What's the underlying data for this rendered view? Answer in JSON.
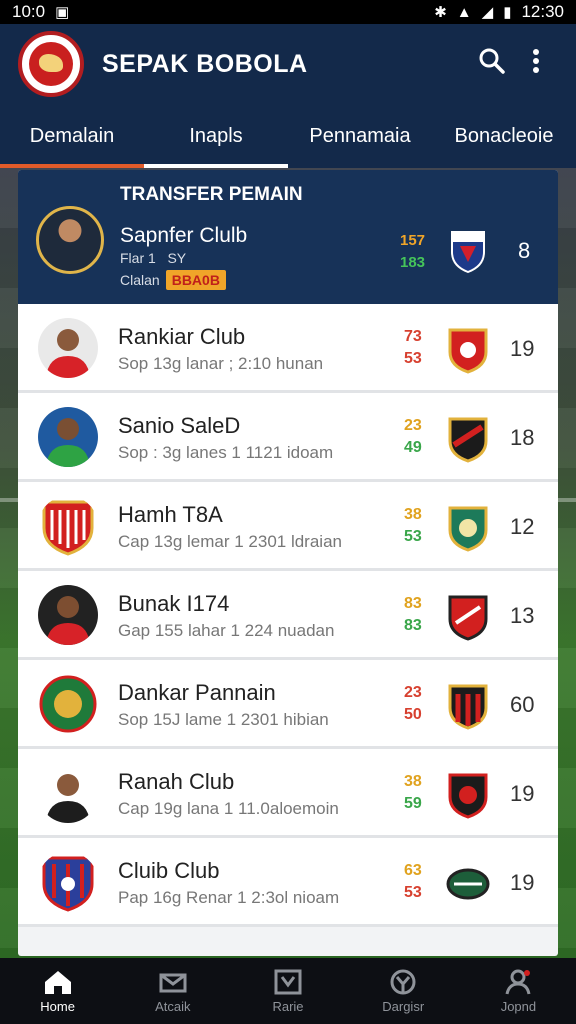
{
  "status_bar": {
    "time_left": "10:0",
    "time_right": "12:30"
  },
  "app": {
    "title": "SEPAK BOBOLA",
    "colors": {
      "header": "#13294a",
      "accent": "#e15b2a"
    }
  },
  "tabs": [
    {
      "label": "Demalain"
    },
    {
      "label": "Inapls"
    },
    {
      "label": "Pennamaia"
    },
    {
      "label": "Bonacleoie"
    }
  ],
  "featured": {
    "caption": "TRANSFER PEMAIN",
    "name": "Sapnfer Clulb",
    "line1": "Flar 1   SY",
    "line2_label": "Clalan",
    "badge": "BBA0B",
    "score_top": "157",
    "score_bottom": "183",
    "number": "8"
  },
  "rows": [
    {
      "name": "Rankiar Club",
      "sub": "Sop 13g   lanar ; 2:10 hunan",
      "score_top": "73",
      "score_bottom": "53",
      "number": "19",
      "top_color": "#d7402f",
      "bottom_color": "#d7402f"
    },
    {
      "name": "Sanio SaleD",
      "sub": "Sop : 3g   lanes 1 1121 idoam",
      "score_top": "23",
      "score_bottom": "49",
      "number": "18",
      "top_color": "#e0a21e",
      "bottom_color": "#3aa64a"
    },
    {
      "name": "Hamh T8A",
      "sub": "Cap 13g   lemar 1 2301 ldraian",
      "score_top": "38",
      "score_bottom": "53",
      "number": "12",
      "top_color": "#e0a21e",
      "bottom_color": "#3aa64a"
    },
    {
      "name": "Bunak I174",
      "sub": "Gap 155   lahar 1 224 nuadan",
      "score_top": "83",
      "score_bottom": "83",
      "number": "13",
      "top_color": "#e0a21e",
      "bottom_color": "#3aa64a"
    },
    {
      "name": "Dankar Pannain",
      "sub": "Sop 15J   lame 1 2301 hibian",
      "score_top": "23",
      "score_bottom": "50",
      "number": "60",
      "top_color": "#d7402f",
      "bottom_color": "#d7402f"
    },
    {
      "name": "Ranah Club",
      "sub": "Cap 19g   lana 1 11.0aloemoin",
      "score_top": "38",
      "score_bottom": "59",
      "number": "19",
      "top_color": "#e0a21e",
      "bottom_color": "#3aa64a"
    },
    {
      "name": "Cluib Club",
      "sub": "Pap 16g   Renar 1 2:3ol nioam",
      "score_top": "63",
      "score_bottom": "53",
      "number": "19",
      "top_color": "#e0a21e",
      "bottom_color": "#d7402f"
    }
  ],
  "bottom_nav": [
    {
      "label": "Home"
    },
    {
      "label": "Atcaik"
    },
    {
      "label": "Rarie"
    },
    {
      "label": "Dargisr"
    },
    {
      "label": "Jopnd"
    }
  ]
}
